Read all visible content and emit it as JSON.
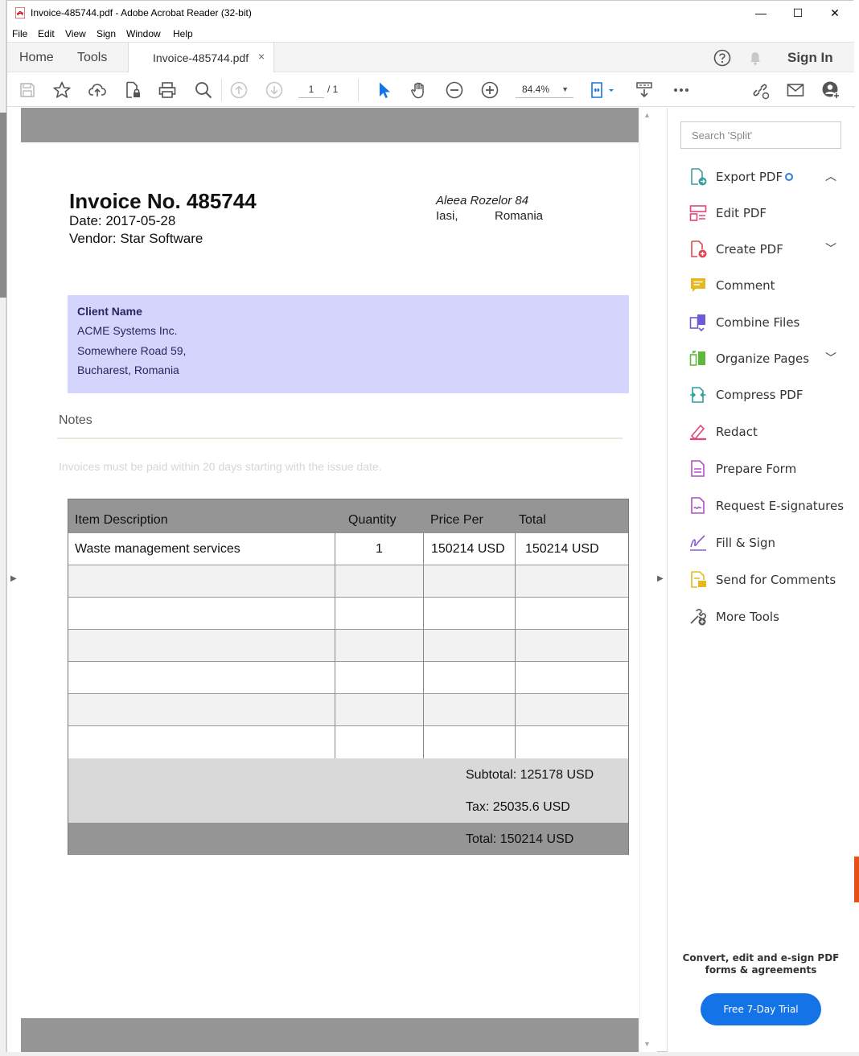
{
  "window": {
    "title": "Invoice-485744.pdf - Adobe Acrobat Reader (32-bit)",
    "minimize": "—",
    "maximize": "☐",
    "close": "✕"
  },
  "menu": [
    "File",
    "Edit",
    "View",
    "Sign",
    "Window",
    "Help"
  ],
  "tabs": {
    "home": "Home",
    "tools": "Tools",
    "document": "Invoice-485744.pdf",
    "close": "×",
    "sign_in": "Sign In"
  },
  "toolbar": {
    "page_current": "1",
    "page_total": "/ 1",
    "zoom": "84.4%"
  },
  "invoice": {
    "title": "Invoice No. 485744",
    "date": "Date: 2017-05-28",
    "vendor": "Vendor: Star Software",
    "address_street": "Aleea Rozelor 84",
    "address_city": "Iasi,",
    "address_country": "Romania",
    "client": {
      "heading": "Client Name",
      "name": "ACME Systems Inc.",
      "street": "Somewhere Road 59,",
      "city": "Bucharest, Romania"
    },
    "notes_heading": "Notes",
    "notes_text": "Invoices must be paid within 20 days starting with the issue date.",
    "table": {
      "headers": [
        "Item Description",
        "Quantity",
        "Price Per",
        "Total"
      ],
      "rows": [
        {
          "description": "Waste management services",
          "quantity": "1",
          "price": "150214 USD",
          "total": "150214 USD"
        }
      ]
    },
    "subtotal": "Subtotal: 125178 USD",
    "tax": "Tax: 25035.6 USD",
    "total": "Total: 150214 USD"
  },
  "right_panel": {
    "search_placeholder": "Search 'Split'",
    "tools": [
      {
        "label": "Export PDF",
        "icon": "export-pdf-icon",
        "color": "#3f9d9d"
      },
      {
        "label": "Edit PDF",
        "icon": "edit-pdf-icon",
        "color": "#e0457b"
      },
      {
        "label": "Create PDF",
        "icon": "create-pdf-icon",
        "color": "#e34850"
      },
      {
        "label": "Comment",
        "icon": "comment-icon",
        "color": "#e5b91d"
      },
      {
        "label": "Combine Files",
        "icon": "combine-files-icon",
        "color": "#6b5bd6"
      },
      {
        "label": "Organize Pages",
        "icon": "organize-pages-icon",
        "color": "#5fb83d"
      },
      {
        "label": "Compress PDF",
        "icon": "compress-pdf-icon",
        "color": "#2aa0a0"
      },
      {
        "label": "Redact",
        "icon": "redact-icon",
        "color": "#e0457b"
      },
      {
        "label": "Prepare Form",
        "icon": "prepare-form-icon",
        "color": "#b04fc5"
      },
      {
        "label": "Request E-signatures",
        "icon": "request-esignatures-icon",
        "color": "#b04fc5"
      },
      {
        "label": "Fill & Sign",
        "icon": "fill-sign-icon",
        "color": "#8b5bd6"
      },
      {
        "label": "Send for Comments",
        "icon": "send-for-comments-icon",
        "color": "#e5b91d"
      },
      {
        "label": "More Tools",
        "icon": "more-tools-icon",
        "color": "#555555"
      }
    ],
    "promo_line1": "Convert, edit and e-sign PDF",
    "promo_line2": "forms & agreements",
    "trial_button": "Free 7-Day Trial"
  }
}
